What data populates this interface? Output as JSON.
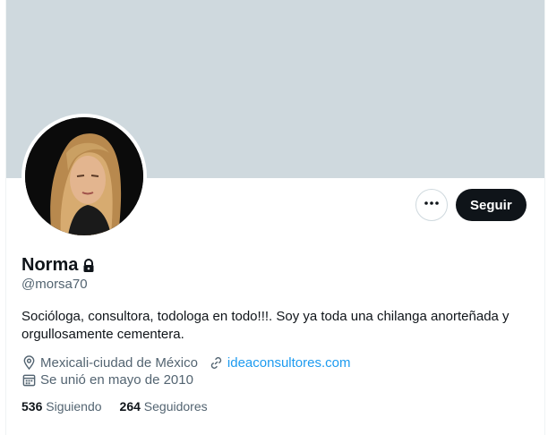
{
  "profile": {
    "name": "Norma",
    "handle": "@morsa70",
    "bio": "Socióloga, consultora, todologa en todo!!!. Soy ya toda una chilanga anorteñada y orgullosamente cementera.",
    "location": "Mexicali-ciudad de México",
    "website": "ideaconsultores.com",
    "joined": "Se unió en mayo de 2010"
  },
  "actions": {
    "follow_label": "Seguir",
    "more_icon": "more-options-icon"
  },
  "stats": {
    "following_count": "536",
    "following_label": "Siguiendo",
    "followers_count": "264",
    "followers_label": "Seguidores"
  },
  "colors": {
    "banner": "#cfd9de",
    "link": "#1d9bf0",
    "secondary_text": "#536471",
    "primary_text": "#0f1419",
    "follow_button": "#0f1419"
  },
  "icons": [
    "lock-icon",
    "location-icon",
    "link-icon",
    "calendar-icon",
    "more-options-icon"
  ]
}
